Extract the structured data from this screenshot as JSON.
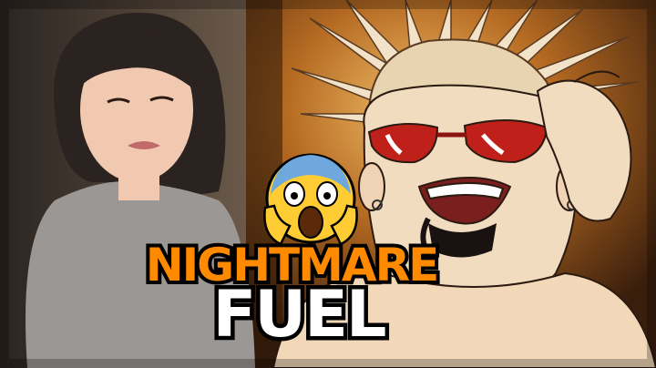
{
  "thumbnail": {
    "title_line_1": "NIGHTMARE",
    "title_line_2": "FUEL",
    "emoji_icon": "face-screaming-in-fear-icon"
  },
  "colors": {
    "title_line_1": "#ff8a00",
    "title_line_2": "#ffffff",
    "outline": "#000000",
    "background": "#b8722c"
  }
}
